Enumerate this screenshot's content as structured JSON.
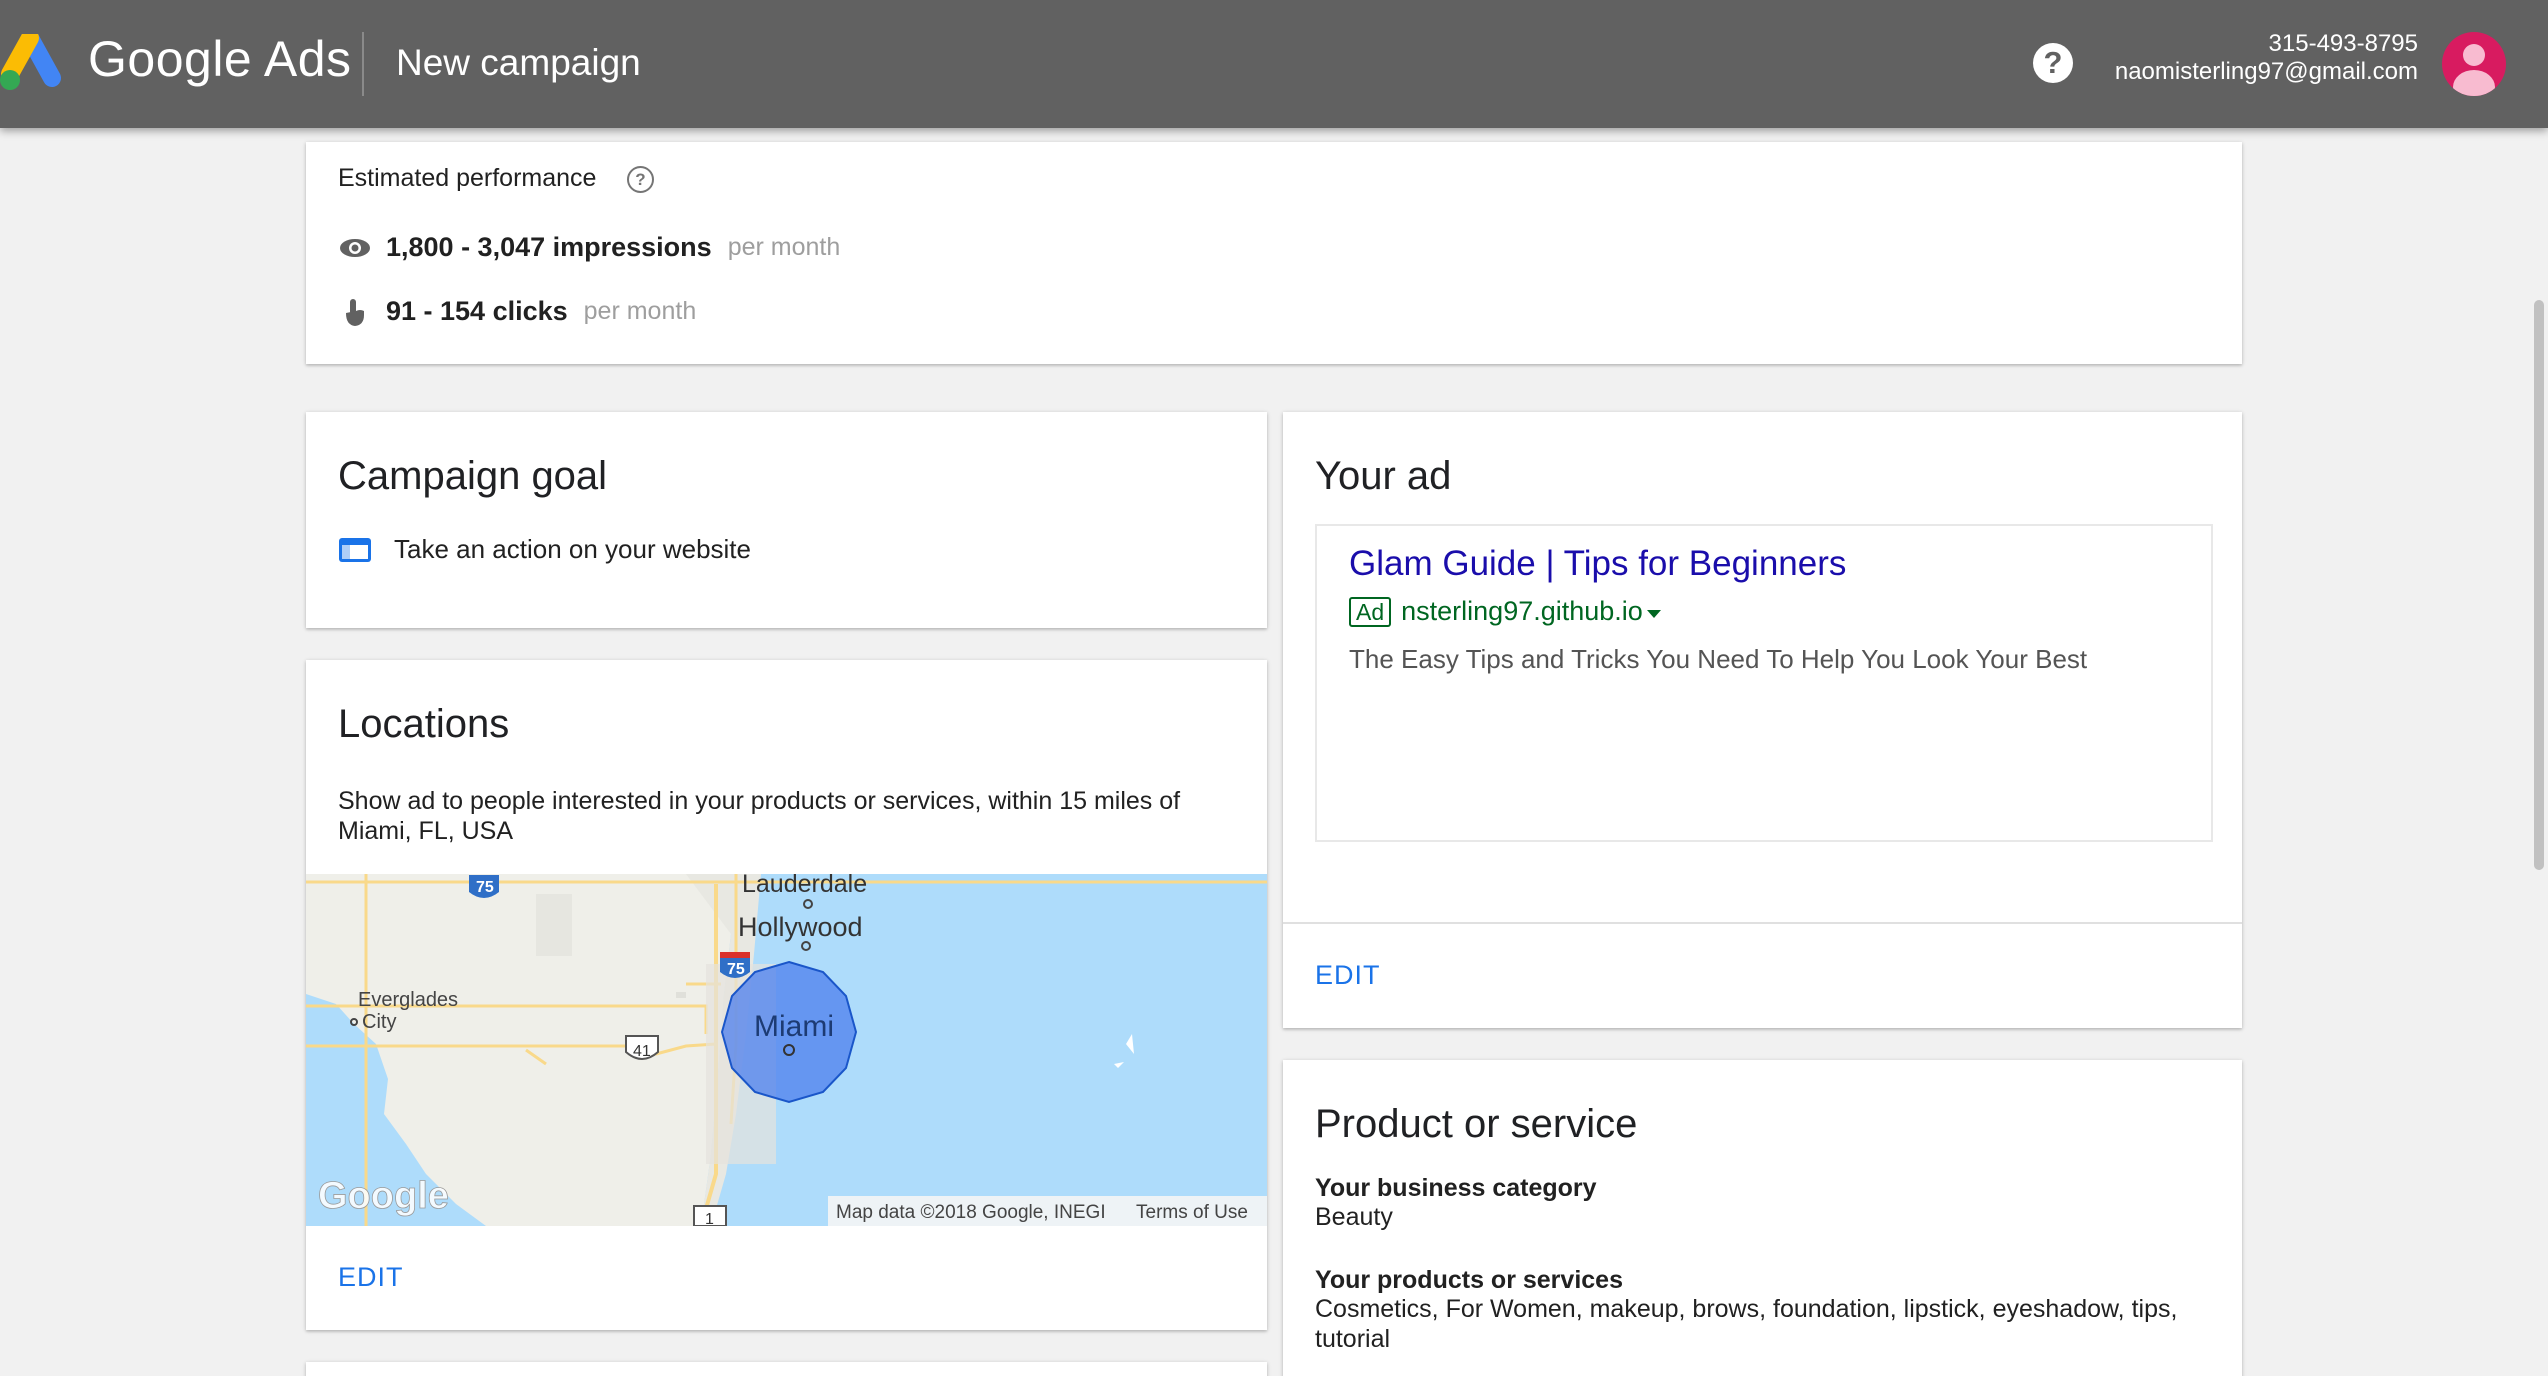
{
  "header": {
    "brand": "Google Ads",
    "page_title": "New campaign",
    "help_symbol": "?",
    "phone": "315-493-8795",
    "email": "naomisterling97@gmail.com"
  },
  "performance": {
    "title": "Estimated performance",
    "impressions": "1,800 - 3,047 impressions",
    "impressions_unit": "per month",
    "clicks": "91 - 154 clicks",
    "clicks_unit": "per month"
  },
  "goal": {
    "title": "Campaign goal",
    "value": "Take an action on your website"
  },
  "locations": {
    "title": "Locations",
    "description": "Show ad to people interested in your products or services, within 15 miles of Miami, FL, USA",
    "edit": "EDIT",
    "map": {
      "places": {
        "lauderdale": "Lauderdale",
        "hollywood": "Hollywood",
        "miami": "Miami",
        "everglades_1": "Everglades",
        "everglades_2": "City"
      },
      "shields": {
        "i75_a": "75",
        "i75_b": "75",
        "us41": "41",
        "us1": "1"
      },
      "watermark": "Google",
      "attribution": "Map data ©2018 Google, INEGI",
      "terms": "Terms of Use"
    }
  },
  "ad": {
    "title": "Your ad",
    "headline": "Glam Guide | Tips for Beginners",
    "badge": "Ad",
    "url": "nsterling97.github.io",
    "description": "The Easy Tips and Tricks You Need To Help You Look Your Best",
    "edit": "EDIT"
  },
  "product": {
    "title": "Product or service",
    "category_label": "Your business category",
    "category_value": "Beauty",
    "products_label": "Your products or services",
    "products_value": "Cosmetics, For Women, makeup, brows, foundation, lipstick, eyeshadow, tips, tutorial"
  },
  "colors": {
    "header_bg": "#616161",
    "accent": "#1a73e8",
    "ad_headline": "#1a0dab",
    "ad_url": "#006621",
    "avatar": "#d81b60"
  }
}
